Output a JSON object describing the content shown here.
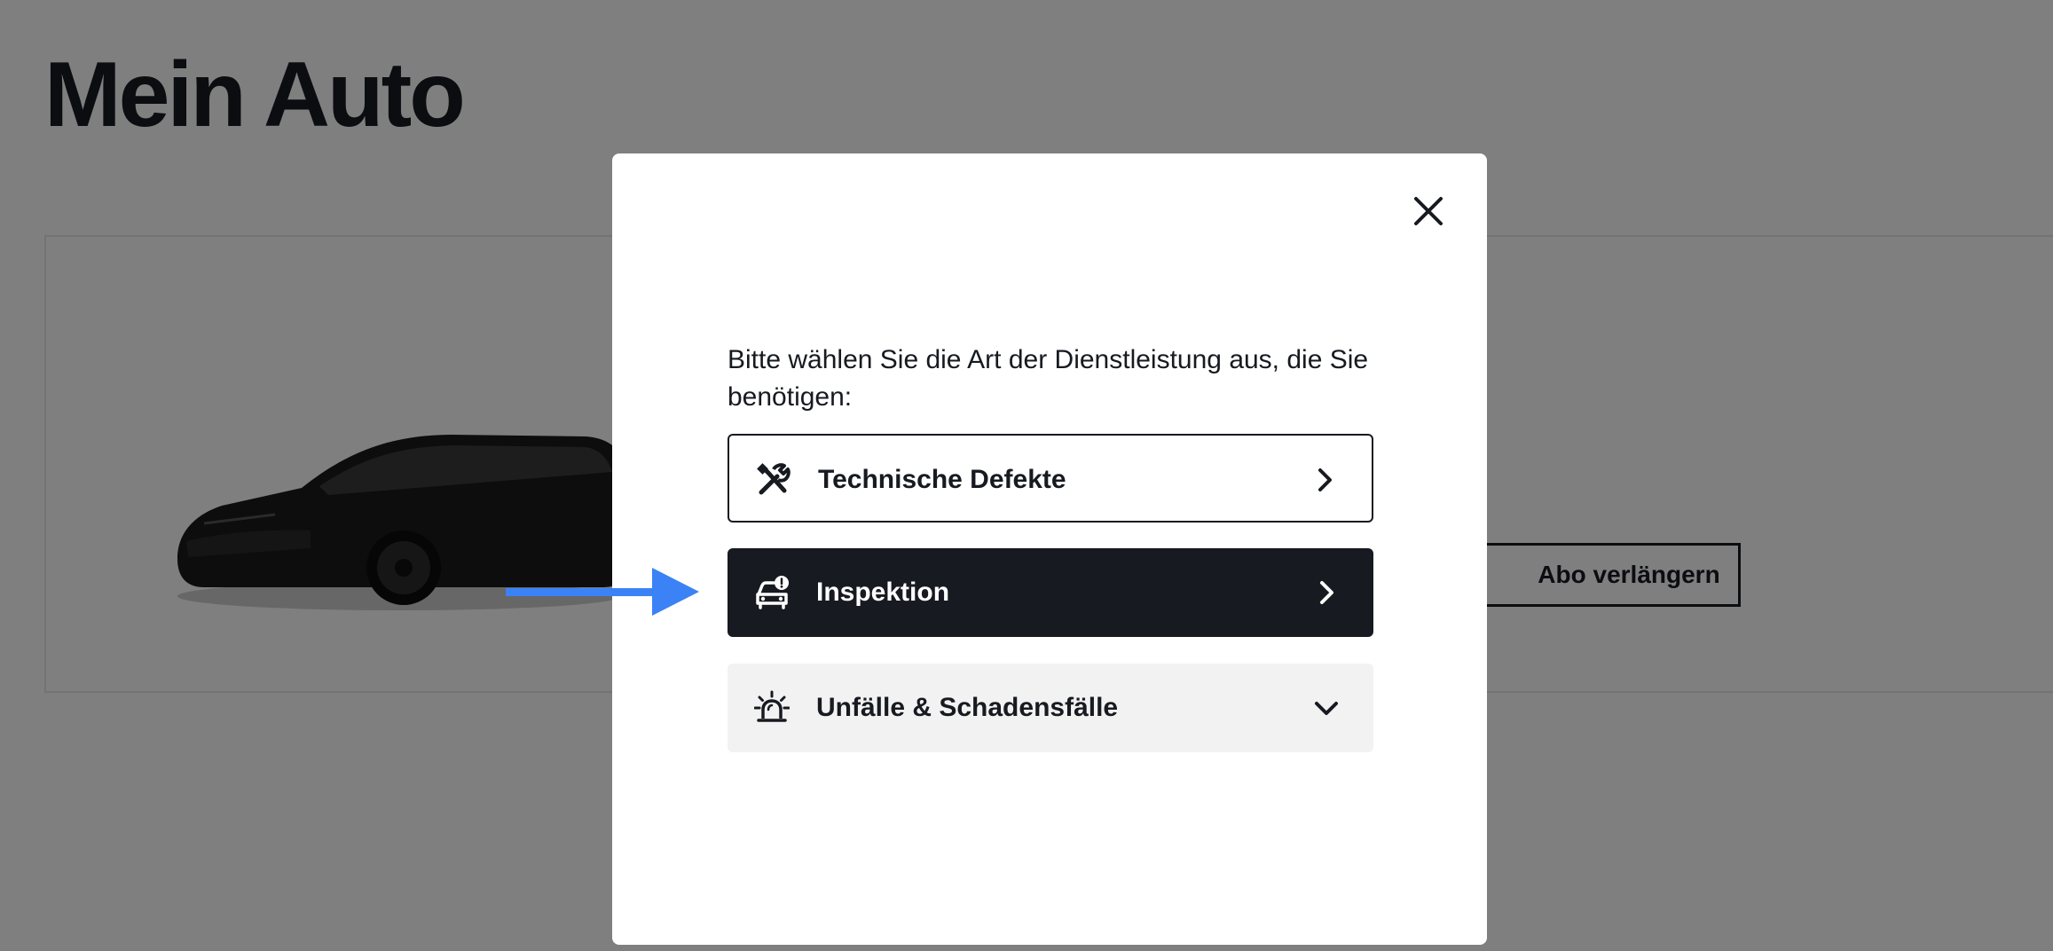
{
  "page": {
    "title": "Mein Auto",
    "renew_button_label": "Abo verlängern"
  },
  "modal": {
    "prompt": "Bitte wählen Sie die Art der Dienstleistung aus, die Sie benötigen:",
    "options": [
      {
        "label": "Technische Defekte",
        "icon": "tools-icon",
        "indicator": "chevron-right-icon"
      },
      {
        "label": "Inspektion",
        "icon": "car-alert-icon",
        "indicator": "chevron-right-icon"
      },
      {
        "label": "Unfälle & Schadensfälle",
        "icon": "siren-icon",
        "indicator": "chevron-down-icon"
      }
    ],
    "close_icon": "close-icon"
  },
  "colors": {
    "text_dark": "#171a20",
    "overlay": "rgba(0,0,0,0.5)",
    "selected_option_bg": "#171a20",
    "collapsed_option_bg": "#f2f2f2",
    "annotation_arrow": "#3b82f6"
  }
}
